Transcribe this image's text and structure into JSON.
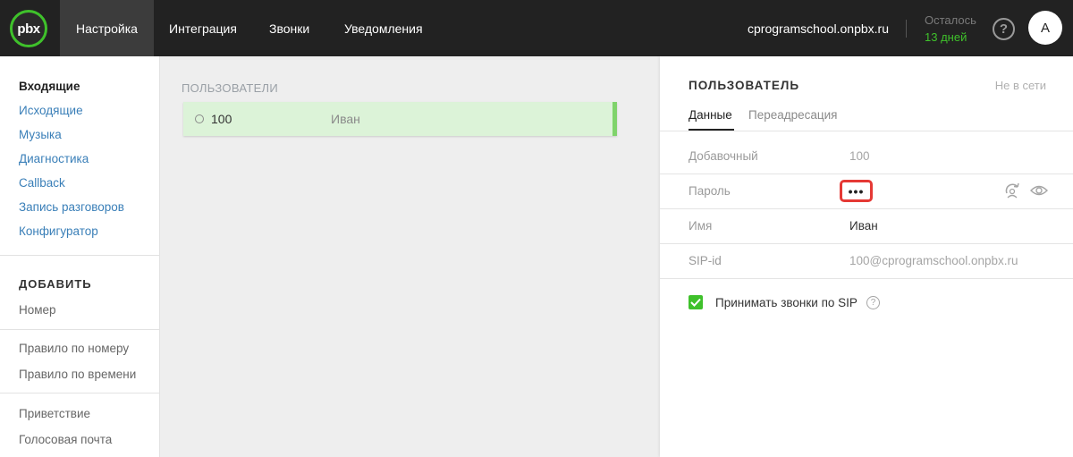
{
  "header": {
    "logo_text": "pbx",
    "nav": [
      {
        "label": "Настройка",
        "active": true
      },
      {
        "label": "Интеграция",
        "active": false
      },
      {
        "label": "Звонки",
        "active": false
      },
      {
        "label": "Уведомления",
        "active": false
      }
    ],
    "domain": "cprogramschool.onpbx.ru",
    "remaining_label": "Осталось",
    "remaining_days": "13 дней",
    "help_symbol": "?",
    "avatar_letter": "A"
  },
  "sidebar": {
    "links": [
      "Входящие",
      "Исходящие",
      "Музыка",
      "Диагностика",
      "Callback",
      "Запись разговоров",
      "Конфигуратор"
    ],
    "add_heading": "ДОБАВИТЬ",
    "add_items": [
      "Номер",
      "Правило по номеру",
      "Правило по времени",
      "Приветствие",
      "Голосовая почта"
    ]
  },
  "users": {
    "title": "ПОЛЬЗОВАТЕЛИ",
    "rows": [
      {
        "number": "100",
        "name": "Иван"
      }
    ]
  },
  "panel": {
    "title": "ПОЛЬЗОВАТЕЛЬ",
    "status": "Не в сети",
    "tabs": [
      "Данные",
      "Переадресация"
    ],
    "fields": [
      {
        "label": "Добавочный",
        "value": "100"
      },
      {
        "label": "Пароль",
        "value": "•••"
      },
      {
        "label": "Имя",
        "value": "Иван"
      },
      {
        "label": "SIP-id",
        "value": "100@cprogramschool.onpbx.ru"
      }
    ],
    "checkbox_label": "Принимать звонки по SIP",
    "checkbox_checked": true
  },
  "colors": {
    "accent_green": "#3fc12b",
    "highlight_red": "#e53935",
    "link_blue": "#3a7fb8",
    "topbar": "#222222"
  }
}
